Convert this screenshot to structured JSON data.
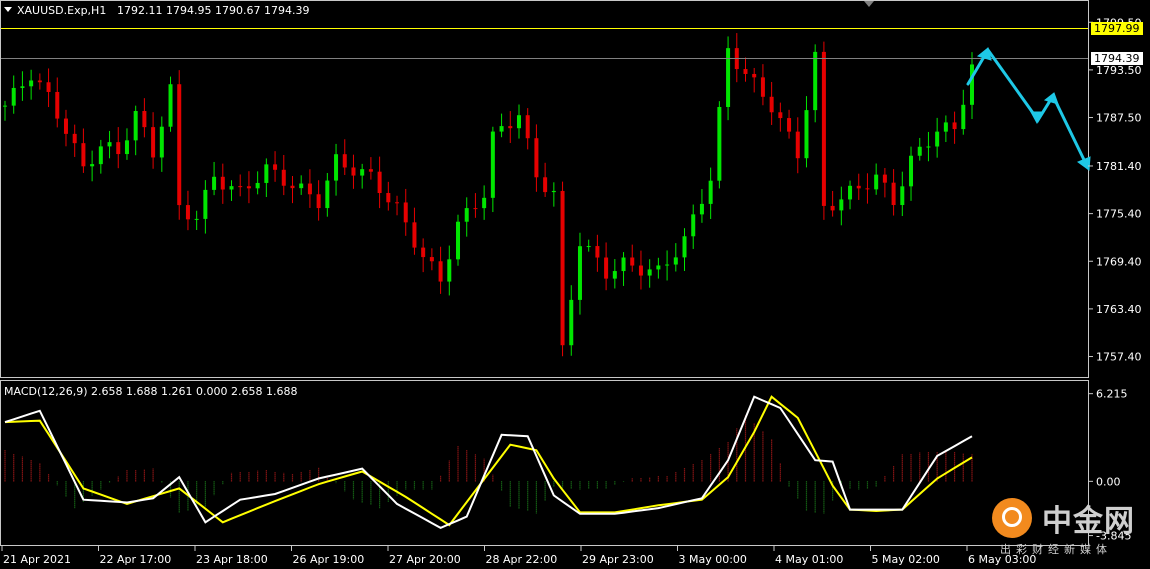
{
  "header": {
    "symbol": "XAUUSD.Exp,H1",
    "ohlc": "1792.11 1794.95 1790.67 1794.39"
  },
  "macd_header": "MACD(12,26,9) 2.658 1.688 1.261 0.000 2.658 1.688",
  "price_axis": {
    "tick_labels": [
      "1799.50",
      "1793.50",
      "1787.50",
      "1781.40",
      "1775.40",
      "1769.40",
      "1763.40",
      "1757.40"
    ],
    "ticks": [
      1799.5,
      1793.5,
      1787.5,
      1781.4,
      1775.4,
      1769.4,
      1763.4,
      1757.4
    ],
    "range": [
      1755.2,
      1801.8
    ]
  },
  "macd_axis": {
    "tick_labels": [
      "6.215",
      "0.00",
      "-3.845"
    ],
    "ticks": [
      6.215,
      0.0,
      -3.845
    ],
    "range": [
      -4.3,
      6.9
    ]
  },
  "time_axis": {
    "labels": [
      "21 Apr 2021",
      "22 Apr 17:00",
      "23 Apr 18:00",
      "26 Apr 19:00",
      "27 Apr 20:00",
      "28 Apr 22:00",
      "29 Apr 23:00",
      "3 May 00:00",
      "4 May 01:00",
      "5 May 02:00",
      "6 May 03:00"
    ]
  },
  "levels": {
    "resistance_line": {
      "value": 1797.99,
      "label": "1797.99",
      "color": "#ffff00"
    },
    "current_price": {
      "value": 1794.39,
      "label": "1794.39",
      "color": "#808080"
    }
  },
  "colors": {
    "bull": "#00e600",
    "bear": "#e60000",
    "macd_line": "#ffffff",
    "signal_line": "#ffff00",
    "hist_pos": "#c81e1e",
    "hist_neg": "#1e8c1e",
    "projection": "#1ec8e6",
    "grid_border": "#c8c8c8"
  },
  "chart_data": [
    {
      "type": "candlestick",
      "symbol": "XAUUSD.Exp",
      "timeframe": "H1",
      "ylim": [
        1755.2,
        1801.8
      ],
      "price_path": [
        [
          0,
          1789
        ],
        [
          3,
          1793
        ],
        [
          5,
          1790
        ],
        [
          7,
          1786
        ],
        [
          9,
          1781
        ],
        [
          11,
          1784
        ],
        [
          13,
          1783
        ],
        [
          15,
          1788
        ],
        [
          17,
          1783
        ],
        [
          19,
          1791
        ],
        [
          20,
          1776
        ],
        [
          22,
          1775
        ],
        [
          24,
          1780
        ],
        [
          27,
          1778
        ],
        [
          30,
          1781
        ],
        [
          33,
          1779
        ],
        [
          36,
          1777
        ],
        [
          38,
          1782
        ],
        [
          42,
          1780
        ],
        [
          45,
          1776
        ],
        [
          48,
          1770
        ],
        [
          50,
          1767
        ],
        [
          52,
          1774
        ],
        [
          55,
          1778
        ],
        [
          56,
          1785
        ],
        [
          59,
          1788
        ],
        [
          61,
          1780
        ],
        [
          63,
          1778
        ],
        [
          64,
          1758
        ],
        [
          66,
          1772
        ],
        [
          69,
          1768
        ],
        [
          71,
          1769
        ],
        [
          75,
          1768
        ],
        [
          78,
          1772
        ],
        [
          81,
          1780
        ],
        [
          83,
          1796
        ],
        [
          85,
          1793
        ],
        [
          88,
          1789
        ],
        [
          91,
          1783
        ],
        [
          93,
          1795
        ],
        [
          94,
          1776
        ],
        [
          97,
          1778
        ],
        [
          100,
          1780
        ],
        [
          102,
          1777
        ],
        [
          104,
          1782
        ],
        [
          107,
          1786
        ],
        [
          109,
          1786
        ],
        [
          111,
          1794
        ]
      ],
      "total_bars": 112
    },
    {
      "type": "line",
      "indicator": "MACD(12,26,9)",
      "ylim": [
        -4.3,
        6.9
      ],
      "series": [
        {
          "name": "MACD",
          "points": [
            [
              0,
              4.2
            ],
            [
              4,
              5.0
            ],
            [
              9,
              -1.3
            ],
            [
              14,
              -1.5
            ],
            [
              17,
              -1.2
            ],
            [
              20,
              0.3
            ],
            [
              23,
              -2.9
            ],
            [
              27,
              -1.3
            ],
            [
              31,
              -0.9
            ],
            [
              36,
              0.2
            ],
            [
              41,
              0.9
            ],
            [
              45,
              -1.6
            ],
            [
              50,
              -3.3
            ],
            [
              53,
              -2.5
            ],
            [
              57,
              3.3
            ],
            [
              60,
              3.2
            ],
            [
              63,
              -1.0
            ],
            [
              66,
              -2.3
            ],
            [
              70,
              -2.3
            ],
            [
              75,
              -1.9
            ],
            [
              80,
              -1.2
            ],
            [
              83,
              1.5
            ],
            [
              86,
              6.0
            ],
            [
              89,
              5.2
            ],
            [
              93,
              1.5
            ],
            [
              95,
              1.4
            ],
            [
              97,
              -2.0
            ],
            [
              100,
              -2.0
            ],
            [
              103,
              -2.0
            ],
            [
              107,
              1.8
            ],
            [
              111,
              3.2
            ]
          ]
        },
        {
          "name": "Signal",
          "points": [
            [
              0,
              4.2
            ],
            [
              4,
              4.3
            ],
            [
              9,
              -0.5
            ],
            [
              14,
              -1.6
            ],
            [
              20,
              -0.5
            ],
            [
              25,
              -2.9
            ],
            [
              31,
              -1.4
            ],
            [
              36,
              -0.2
            ],
            [
              41,
              0.7
            ],
            [
              46,
              -1.1
            ],
            [
              51,
              -3.1
            ],
            [
              58,
              2.6
            ],
            [
              61,
              2.2
            ],
            [
              63,
              0.2
            ],
            [
              66,
              -2.2
            ],
            [
              70,
              -2.2
            ],
            [
              75,
              -1.7
            ],
            [
              80,
              -1.3
            ],
            [
              83,
              0.3
            ],
            [
              86,
              3.5
            ],
            [
              88,
              6.0
            ],
            [
              91,
              4.5
            ],
            [
              95,
              -0.3
            ],
            [
              97,
              -2.0
            ],
            [
              100,
              -2.1
            ],
            [
              103,
              -2.0
            ],
            [
              107,
              0.2
            ],
            [
              111,
              1.7
            ]
          ]
        },
        {
          "name": "Histogram",
          "points": [
            [
              0,
              2.2
            ],
            [
              4,
              1.3
            ],
            [
              8,
              -1.9
            ],
            [
              11,
              -0.6
            ],
            [
              14,
              0.8
            ],
            [
              17,
              0.9
            ],
            [
              20,
              -2.2
            ],
            [
              23,
              -1.8
            ],
            [
              26,
              0.6
            ],
            [
              30,
              0.8
            ],
            [
              33,
              0.5
            ],
            [
              36,
              1.0
            ],
            [
              40,
              -1.3
            ],
            [
              43,
              -1.9
            ],
            [
              46,
              -0.6
            ],
            [
              49,
              -0.6
            ],
            [
              52,
              2.5
            ],
            [
              55,
              1.6
            ],
            [
              58,
              -1.8
            ],
            [
              61,
              -2.3
            ],
            [
              63,
              -0.4
            ],
            [
              66,
              -0.6
            ],
            [
              69,
              -0.5
            ],
            [
              72,
              0.2
            ],
            [
              76,
              0.4
            ],
            [
              80,
              1.5
            ],
            [
              83,
              2.8
            ],
            [
              85,
              4.7
            ],
            [
              88,
              3.0
            ],
            [
              90,
              -0.4
            ],
            [
              92,
              -2.1
            ],
            [
              94,
              -2.3
            ],
            [
              96,
              -0.5
            ],
            [
              98,
              -0.6
            ],
            [
              100,
              -0.4
            ],
            [
              103,
              1.9
            ],
            [
              106,
              2.1
            ],
            [
              109,
              2.1
            ],
            [
              111,
              1.9
            ]
          ]
        }
      ]
    }
  ]
}
